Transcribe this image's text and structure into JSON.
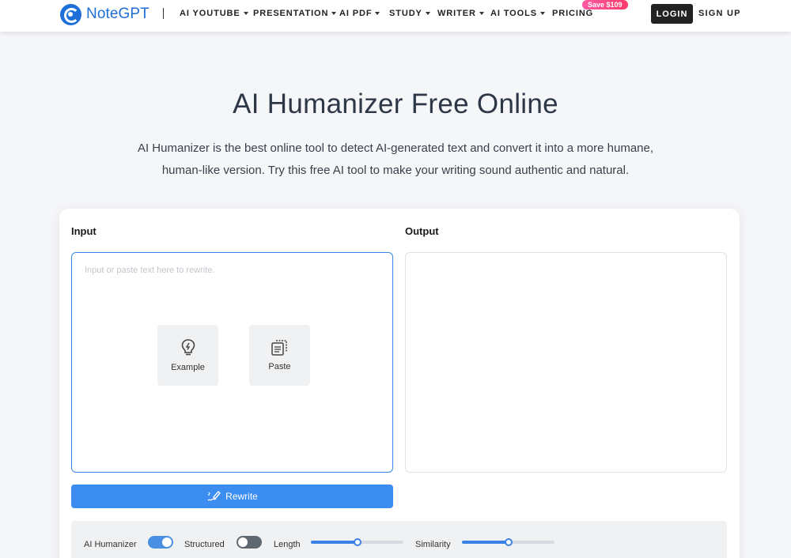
{
  "header": {
    "brand": "NoteGPT",
    "nav": [
      {
        "label": "AI YOUTUBE",
        "has_caret": true
      },
      {
        "label": "PRESENTATION",
        "has_caret": true
      },
      {
        "label": "AI PDF",
        "has_caret": true
      },
      {
        "label": "STUDY",
        "has_caret": true
      },
      {
        "label": "WRITER",
        "has_caret": true
      },
      {
        "label": "AI TOOLS",
        "has_caret": true
      },
      {
        "label": "PRICING",
        "has_caret": false
      }
    ],
    "save_badge": "Save $109",
    "login_label": "LOGIN",
    "signup_label": "SIGN UP"
  },
  "hero": {
    "title": "AI Humanizer Free Online",
    "description": "AI Humanizer is the best online tool to detect AI-generated text and convert it into a more humane, human-like version. Try this free AI tool to make your writing sound authentic and natural."
  },
  "tool": {
    "input_label": "Input",
    "output_label": "Output",
    "input_placeholder": "Input or paste text here to rewrite.",
    "input_value": "",
    "output_value": "",
    "actions": {
      "example_label": "Example",
      "paste_label": "Paste"
    },
    "rewrite_label": "Rewrite",
    "settings": {
      "humanizer_label": "AI Humanizer",
      "humanizer_on": true,
      "structured_label": "Structured",
      "structured_on": false,
      "length_label": "Length",
      "length_value": 0.5,
      "similarity_label": "Similarity",
      "similarity_value": 0.5
    }
  },
  "colors": {
    "brand": "#1f6fd8",
    "primary_button": "#3b8ef0",
    "toggle_on": "#4a90e2",
    "toggle_off": "#5f6770",
    "badge": "#ff3b6b"
  }
}
